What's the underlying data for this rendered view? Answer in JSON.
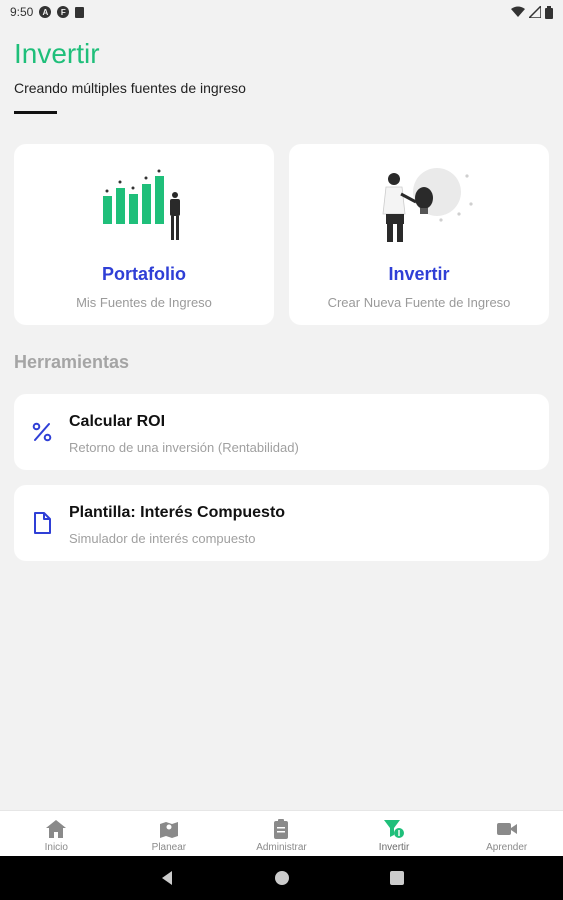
{
  "status_bar": {
    "time": "9:50",
    "icon_a": "A",
    "icon_b": "F"
  },
  "header": {
    "title": "Invertir",
    "subtitle": "Creando múltiples fuentes de ingreso"
  },
  "cards": [
    {
      "title": "Portafolio",
      "subtitle": "Mis Fuentes de Ingreso"
    },
    {
      "title": "Invertir",
      "subtitle": "Crear Nueva Fuente de Ingreso"
    }
  ],
  "tools_section": {
    "title": "Herramientas",
    "items": [
      {
        "title": "Calcular ROI",
        "subtitle": "Retorno de una inversión (Rentabilidad)",
        "icon": "percent-icon"
      },
      {
        "title": "Plantilla: Interés Compuesto",
        "subtitle": "Simulador de interés compuesto",
        "icon": "document-icon"
      }
    ]
  },
  "bottom_nav": {
    "items": [
      {
        "label": "Inicio",
        "icon": "home-icon"
      },
      {
        "label": "Planear",
        "icon": "map-icon"
      },
      {
        "label": "Administrar",
        "icon": "clipboard-icon"
      },
      {
        "label": "Invertir",
        "icon": "funnel-dollar-icon",
        "active": true
      },
      {
        "label": "Aprender",
        "icon": "video-icon"
      }
    ]
  },
  "colors": {
    "accent_green": "#1fbf7a",
    "accent_blue": "#2f3fd6",
    "background": "#f2f2f2"
  }
}
